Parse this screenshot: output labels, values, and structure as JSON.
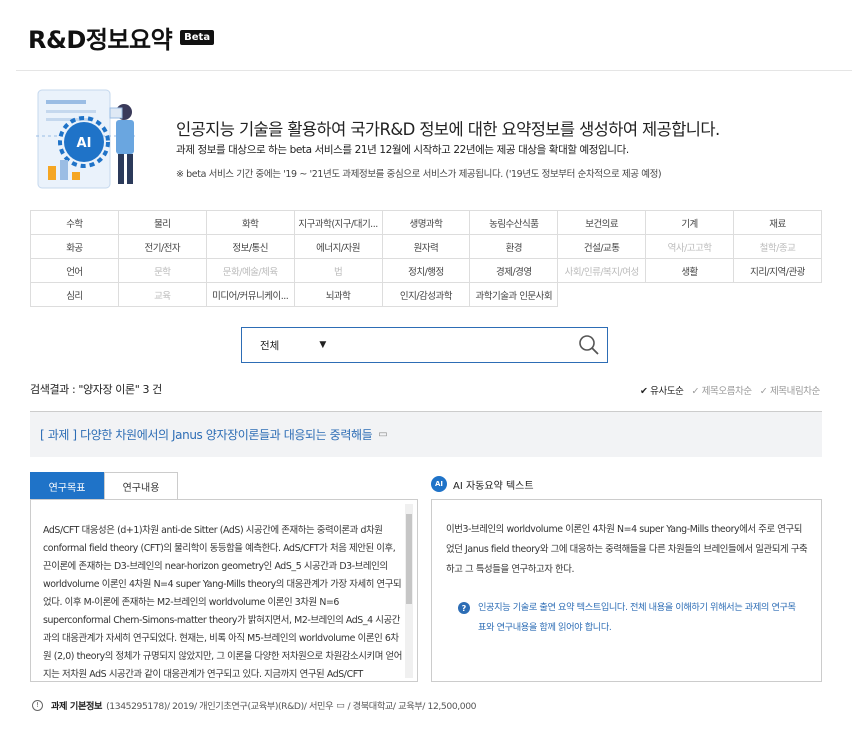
{
  "header": {
    "title": "R&D정보요약",
    "badge": "Beta"
  },
  "intro": {
    "headline": "인공지능 기술을 활용하여 국가R&D 정보에 대한 요약정보를 생성하여 제공합니다.",
    "subline": "과제 정보를 대상으로 하는 beta 서비스를 21년 12월에 시작하고 22년에는 제공 대상을 확대할 예정입니다.",
    "note": "※ beta 서비스 기간 중에는 '19 ~ '21년도 과제정보를 중심으로 서비스가 제공됩니다. ('19년도 정보부터 순차적으로 제공 예정)",
    "illustration_label": "AI"
  },
  "categories": [
    [
      {
        "label": "수학",
        "enabled": true
      },
      {
        "label": "물리",
        "enabled": true
      },
      {
        "label": "화학",
        "enabled": true
      },
      {
        "label": "지구과학(지구/대기...",
        "enabled": true
      },
      {
        "label": "생명과학",
        "enabled": true
      },
      {
        "label": "농림수산식품",
        "enabled": true
      },
      {
        "label": "보건의료",
        "enabled": true
      },
      {
        "label": "기계",
        "enabled": true
      },
      {
        "label": "재료",
        "enabled": true
      }
    ],
    [
      {
        "label": "화공",
        "enabled": true
      },
      {
        "label": "전기/전자",
        "enabled": true
      },
      {
        "label": "정보/통신",
        "enabled": true
      },
      {
        "label": "에너지/자원",
        "enabled": true
      },
      {
        "label": "원자력",
        "enabled": true
      },
      {
        "label": "환경",
        "enabled": true
      },
      {
        "label": "건설/교통",
        "enabled": true
      },
      {
        "label": "역사/고고학",
        "enabled": false
      },
      {
        "label": "철학/종교",
        "enabled": false
      }
    ],
    [
      {
        "label": "언어",
        "enabled": true
      },
      {
        "label": "문학",
        "enabled": false
      },
      {
        "label": "문화/예술/체육",
        "enabled": false
      },
      {
        "label": "법",
        "enabled": false
      },
      {
        "label": "정치/행정",
        "enabled": true
      },
      {
        "label": "경제/경영",
        "enabled": true
      },
      {
        "label": "사회/인류/복지/여성",
        "enabled": false
      },
      {
        "label": "생활",
        "enabled": true
      },
      {
        "label": "지리/지역/관광",
        "enabled": true
      }
    ],
    [
      {
        "label": "심리",
        "enabled": true
      },
      {
        "label": "교육",
        "enabled": false
      },
      {
        "label": "미디어/커뮤니케이...",
        "enabled": true
      },
      {
        "label": "뇌과학",
        "enabled": true
      },
      {
        "label": "인지/감성과학",
        "enabled": true
      },
      {
        "label": "과학기술과 인문사회",
        "enabled": true
      },
      {
        "label": "",
        "enabled": true
      },
      {
        "label": "",
        "enabled": true
      },
      {
        "label": "",
        "enabled": true
      }
    ]
  ],
  "search": {
    "scope_value": "전체",
    "query_value": ""
  },
  "results": {
    "summary": "검색결과 : \"양자장 이론\" 3 건",
    "sort_options": [
      {
        "label": "✔ 유사도순",
        "active": true
      },
      {
        "label": "✓ 제목오름차순",
        "active": false
      },
      {
        "label": "✓ 제목내림차순",
        "active": false
      }
    ],
    "item_title": "[ 과제 ] 다양한 차원에서의 Janus 양자장이론들과 대응되는 중력해들"
  },
  "tabs": [
    {
      "label": "연구목표",
      "active": true
    },
    {
      "label": "연구내용",
      "active": false
    }
  ],
  "research_goal_text": "AdS/CFT 대응성은 (d+1)차원 anti-de Sitter (AdS) 시공간에 존재하는 중력이론과 d차원 conformal field theory (CFT)의 물리학이 동등함을 예측한다. AdS/CFT가 처음 제안된 이후, 끈이론에 존재하는 D3-브레인의 near-horizon geometry인 AdS_5 시공간과 D3-브레인의 worldvolume 이론인 4차원 N=4 super Yang-Mills theory의 대응관계가 가장 자세히 연구되었다. 이후 M-이론에 존재하는 M2-브레인의 worldvolume 이론인 3차원 N=6 superconformal Chern-Simons-matter theory가 밝혀지면서, M2-브레인의 AdS_4 시공간과의 대응관계가 자세히 연구되었다. 현재는, 비록 아직 M5-브레인의 worldvolume 이론인 6차원 (2,0) theory의 정체가 규명되지 않았지만, 그 이론을 다양한 저차원으로 차원감소시키며 얻어지는 저차원 AdS 시공간과 같이 대응관계가 연구되고 있다. 지금까지 연구된 AdS/CFT",
  "ai_summary": {
    "heading": "AI 자동요약 텍스트",
    "badge": "AI",
    "text": "이번3-브레인의 worldvolume 이론인 4차원 N=4 super Yang-Mills theory에서 주로 연구되었던 Janus field theory와 그에 대응하는 중력해들을 다른 차원들의 브레인들에서 일관되게 구축하고 그 특성들을 연구하고자 한다.",
    "notice": "인공지능 기술로 출연 요약 텍스트입니다. 전체 내용을 이해하기 위해서는 과제의 연구목표와 연구내용을 함께 읽어야 합니다."
  },
  "footer": {
    "label": "과제 기본정보",
    "info_left": "(1345295178)/ 2019/ 개인기초연구(교육부)(R&D)/ 서민우",
    "info_right": "/ 경북대학교/ 교육부/ 12,500,000"
  },
  "colors": {
    "accent": "#1f73c8",
    "link": "#2d6db5",
    "border": "#cccccc"
  },
  "icons": [
    "search-icon",
    "document-icon",
    "info-icon",
    "question-icon",
    "ai-badge-icon"
  ]
}
